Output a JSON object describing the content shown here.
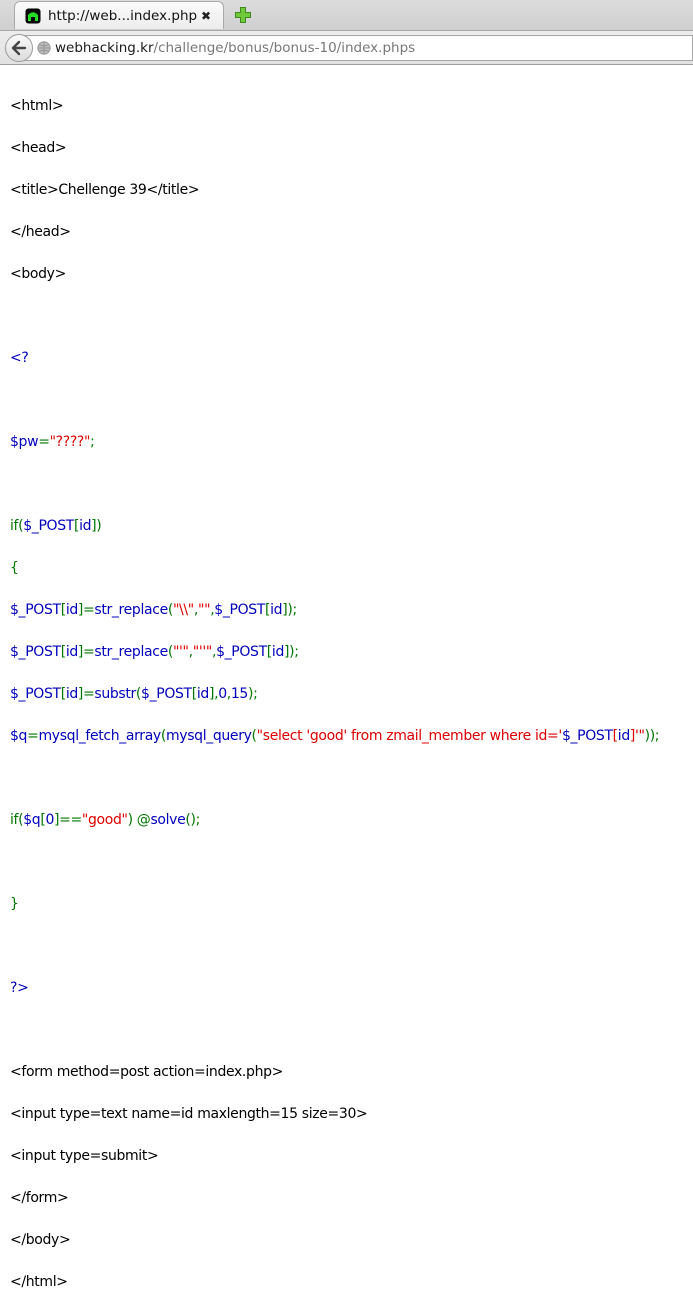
{
  "tab": {
    "title": "http://web...index.phps"
  },
  "address": {
    "host": "webhacking.kr",
    "path": "/challenge/bonus/bonus-10/index.phps"
  },
  "colors": {
    "html": "#000000",
    "php_default": "#0000bb",
    "php_keyword": "#007700",
    "php_string": "#dd0000"
  },
  "source": {
    "l1": "<html>",
    "l2": "<head>",
    "l3": "<title>Chellenge 39</title>",
    "l4": "</head>",
    "l5": "<body>",
    "l7": "<?",
    "l9a": "$pw",
    "l9b": "=",
    "l9c": "\"????\"",
    "l9d": ";",
    "l11a": "if(",
    "l11b": "$_POST",
    "l11c": "[",
    "l11d": "id",
    "l11e": "])",
    "l12": "{",
    "l13a": "$_POST",
    "l13b": "[",
    "l13c": "id",
    "l13d": "]=",
    "l13e": "str_replace",
    "l13f": "(",
    "l13g": "\"\\\\\"",
    "l13h": ",",
    "l13i": "\"\"",
    "l13j": ",",
    "l13k": "$_POST",
    "l13l": "[",
    "l13m": "id",
    "l13n": "]);",
    "l14a": "$_POST",
    "l14b": "[",
    "l14c": "id",
    "l14d": "]=",
    "l14e": "str_replace",
    "l14f": "(",
    "l14g": "\"'\"",
    "l14h": ",",
    "l14i": "\"''\"",
    "l14j": ",",
    "l14k": "$_POST",
    "l14l": "[",
    "l14m": "id",
    "l14n": "]);",
    "l15a": "$_POST",
    "l15b": "[",
    "l15c": "id",
    "l15d": "]=",
    "l15e": "substr",
    "l15f": "(",
    "l15g": "$_POST",
    "l15h": "[",
    "l15i": "id",
    "l15j": "],",
    "l15k": "0",
    "l15l": ",",
    "l15m": "15",
    "l15n": ");",
    "l16a": "$q",
    "l16b": "=",
    "l16c": "mysql_fetch_array",
    "l16d": "(",
    "l16e": "mysql_query",
    "l16f": "(",
    "l16g": "\"select 'good' from zmail_member where id='",
    "l16h": "$_POST",
    "l16i": "[",
    "l16j": "id",
    "l16k": "]",
    "l16l": "'\"",
    "l16m": "));",
    "l18a": "if(",
    "l18b": "$q",
    "l18c": "[",
    "l18d": "0",
    "l18e": "]==",
    "l18f": "\"good\"",
    "l18g": ") @",
    "l18h": "solve",
    "l18i": "();",
    "l20": "}",
    "l22": "?>",
    "l24": "<form method=post action=index.php>",
    "l25": "<input type=text name=id maxlength=15 size=30>",
    "l26": "<input type=submit>",
    "l27": "</form>",
    "l28": "</body>",
    "l29": "</html>"
  }
}
